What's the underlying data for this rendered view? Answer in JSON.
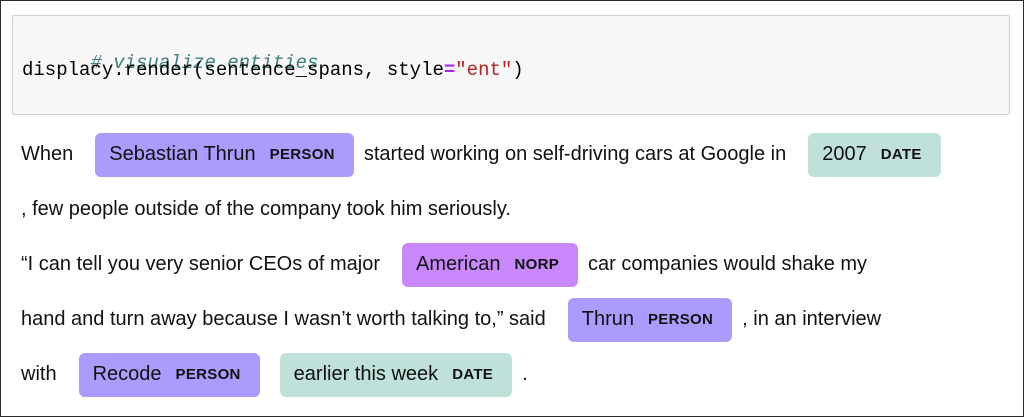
{
  "code": {
    "comment": "# visualize entities",
    "call_prefix": "displacy.render(sentence_spans, style",
    "operator": "=",
    "string": "\"ent\"",
    "call_suffix": ")"
  },
  "colors": {
    "PERSON": "#aa9cfc",
    "DATE": "#bfe1d9",
    "NORP": "#c887fb"
  },
  "output": {
    "line1": {
      "t1": "When",
      "e1_text": "Sebastian Thrun",
      "e1_label": "PERSON",
      "t2": "started working on self-driving cars at Google in",
      "e2_text": "2007",
      "e2_label": "DATE"
    },
    "line2": {
      "t1": ", few people outside of the company took him seriously."
    },
    "line3": {
      "t1": "“I can tell you very senior CEOs of major",
      "e1_text": "American",
      "e1_label": "NORP",
      "t2": "car companies would shake my"
    },
    "line4": {
      "t1": "hand and turn away because I wasn’t worth talking to,” said",
      "e1_text": "Thrun",
      "e1_label": "PERSON",
      "t2": ", in an interview"
    },
    "line5": {
      "t1": "with",
      "e1_text": "Recode",
      "e1_label": "PERSON",
      "e2_text": "earlier this week",
      "e2_label": "DATE",
      "t2": "."
    }
  }
}
